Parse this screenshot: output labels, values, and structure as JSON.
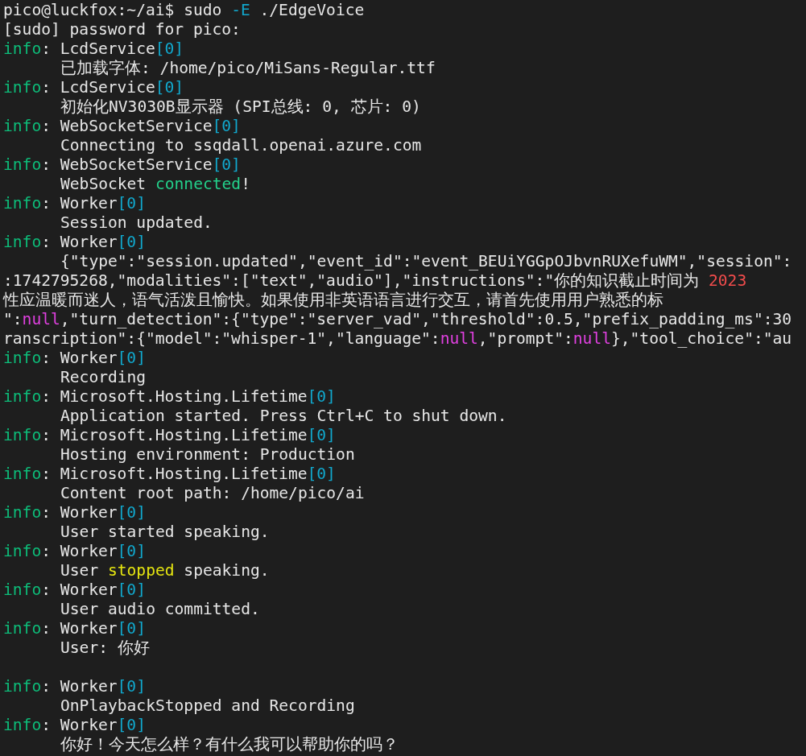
{
  "terminal": {
    "lines": [
      {
        "indent": false,
        "segments": [
          {
            "text": "pico@luckfox:~/ai$ sudo ",
            "color": "#e6e6e6"
          },
          {
            "text": "-E",
            "color": "#11a8cd"
          },
          {
            "text": " ./EdgeVoice",
            "color": "#e6e6e6"
          }
        ]
      },
      {
        "indent": false,
        "segments": [
          {
            "text": "[sudo] password for pico:",
            "color": "#e6e6e6"
          }
        ]
      },
      {
        "indent": false,
        "segments": [
          {
            "text": "info",
            "color": "#0dbc79"
          },
          {
            "text": ": LcdService",
            "color": "#e6e6e6"
          },
          {
            "text": "[0]",
            "color": "#11a8cd"
          }
        ]
      },
      {
        "indent": true,
        "segments": [
          {
            "text": "已加载字体: /home/pico/MiSans-Regular.ttf",
            "color": "#e6e6e6"
          }
        ]
      },
      {
        "indent": false,
        "segments": [
          {
            "text": "info",
            "color": "#0dbc79"
          },
          {
            "text": ": LcdService",
            "color": "#e6e6e6"
          },
          {
            "text": "[0]",
            "color": "#11a8cd"
          }
        ]
      },
      {
        "indent": true,
        "segments": [
          {
            "text": "初始化NV3030B显示器 (SPI总线: 0, 芯片: 0)",
            "color": "#e6e6e6"
          }
        ]
      },
      {
        "indent": false,
        "segments": [
          {
            "text": "info",
            "color": "#0dbc79"
          },
          {
            "text": ": WebSocketService",
            "color": "#e6e6e6"
          },
          {
            "text": "[0]",
            "color": "#11a8cd"
          }
        ]
      },
      {
        "indent": true,
        "segments": [
          {
            "text": "Connecting to ssqdall.openai.azure.com",
            "color": "#e6e6e6"
          }
        ]
      },
      {
        "indent": false,
        "segments": [
          {
            "text": "info",
            "color": "#0dbc79"
          },
          {
            "text": ": WebSocketService",
            "color": "#e6e6e6"
          },
          {
            "text": "[0]",
            "color": "#11a8cd"
          }
        ]
      },
      {
        "indent": true,
        "segments": [
          {
            "text": "WebSocket ",
            "color": "#e6e6e6"
          },
          {
            "text": "connected",
            "color": "#23d18b"
          },
          {
            "text": "!",
            "color": "#e6e6e6"
          }
        ]
      },
      {
        "indent": false,
        "segments": [
          {
            "text": "info",
            "color": "#0dbc79"
          },
          {
            "text": ": Worker",
            "color": "#e6e6e6"
          },
          {
            "text": "[0]",
            "color": "#11a8cd"
          }
        ]
      },
      {
        "indent": true,
        "segments": [
          {
            "text": "Session updated.",
            "color": "#e6e6e6"
          }
        ]
      },
      {
        "indent": false,
        "segments": [
          {
            "text": "info",
            "color": "#0dbc79"
          },
          {
            "text": ": Worker",
            "color": "#e6e6e6"
          },
          {
            "text": "[0]",
            "color": "#11a8cd"
          }
        ]
      },
      {
        "indent": true,
        "segments": [
          {
            "text": "{\"type\":\"session.updated\",\"event_id\":\"event_BEUiYGGpOJbvnRUXefuWM\",\"session\":",
            "color": "#e6e6e6"
          }
        ]
      },
      {
        "indent": false,
        "segments": [
          {
            "text": ":1742795268,\"modalities\":[\"text\",\"audio\"],\"instructions\":\"你的知识截止时间为 ",
            "color": "#e6e6e6"
          },
          {
            "text": "2023",
            "color": "#f14c4c"
          }
        ]
      },
      {
        "indent": false,
        "segments": [
          {
            "text": "性应温暖而迷人，语气活泼且愉快。如果使用非英语语言进行交互，请首先使用用户熟悉的标",
            "color": "#e6e6e6"
          }
        ]
      },
      {
        "indent": false,
        "segments": [
          {
            "text": "\":",
            "color": "#e6e6e6"
          },
          {
            "text": "null",
            "color": "#e040e0"
          },
          {
            "text": ",\"turn_detection\":{\"type\":\"server_vad\",\"threshold\":0.5,\"prefix_padding_ms\":30",
            "color": "#e6e6e6"
          }
        ]
      },
      {
        "indent": false,
        "segments": [
          {
            "text": "ranscription\":{\"model\":\"whisper-1\",\"language\":",
            "color": "#e6e6e6"
          },
          {
            "text": "null",
            "color": "#e040e0"
          },
          {
            "text": ",\"prompt\":",
            "color": "#e6e6e6"
          },
          {
            "text": "null",
            "color": "#e040e0"
          },
          {
            "text": "},\"tool_choice\":\"au",
            "color": "#e6e6e6"
          }
        ]
      },
      {
        "indent": false,
        "segments": [
          {
            "text": "info",
            "color": "#0dbc79"
          },
          {
            "text": ": Worker",
            "color": "#e6e6e6"
          },
          {
            "text": "[0]",
            "color": "#11a8cd"
          }
        ]
      },
      {
        "indent": true,
        "segments": [
          {
            "text": "Recording",
            "color": "#e6e6e6"
          }
        ]
      },
      {
        "indent": false,
        "segments": [
          {
            "text": "info",
            "color": "#0dbc79"
          },
          {
            "text": ": Microsoft.Hosting.Lifetime",
            "color": "#e6e6e6"
          },
          {
            "text": "[0]",
            "color": "#11a8cd"
          }
        ]
      },
      {
        "indent": true,
        "segments": [
          {
            "text": "Application started. Press Ctrl+C to shut down.",
            "color": "#e6e6e6"
          }
        ]
      },
      {
        "indent": false,
        "segments": [
          {
            "text": "info",
            "color": "#0dbc79"
          },
          {
            "text": ": Microsoft.Hosting.Lifetime",
            "color": "#e6e6e6"
          },
          {
            "text": "[0]",
            "color": "#11a8cd"
          }
        ]
      },
      {
        "indent": true,
        "segments": [
          {
            "text": "Hosting environment: Production",
            "color": "#e6e6e6"
          }
        ]
      },
      {
        "indent": false,
        "segments": [
          {
            "text": "info",
            "color": "#0dbc79"
          },
          {
            "text": ": Microsoft.Hosting.Lifetime",
            "color": "#e6e6e6"
          },
          {
            "text": "[0]",
            "color": "#11a8cd"
          }
        ]
      },
      {
        "indent": true,
        "segments": [
          {
            "text": "Content root path: /home/pico/ai",
            "color": "#e6e6e6"
          }
        ]
      },
      {
        "indent": false,
        "segments": [
          {
            "text": "info",
            "color": "#0dbc79"
          },
          {
            "text": ": Worker",
            "color": "#e6e6e6"
          },
          {
            "text": "[0]",
            "color": "#11a8cd"
          }
        ]
      },
      {
        "indent": true,
        "segments": [
          {
            "text": "User started speaking.",
            "color": "#e6e6e6"
          }
        ]
      },
      {
        "indent": false,
        "segments": [
          {
            "text": "info",
            "color": "#0dbc79"
          },
          {
            "text": ": Worker",
            "color": "#e6e6e6"
          },
          {
            "text": "[0]",
            "color": "#11a8cd"
          }
        ]
      },
      {
        "indent": true,
        "segments": [
          {
            "text": "User ",
            "color": "#e6e6e6"
          },
          {
            "text": "stopped",
            "color": "#e5e510"
          },
          {
            "text": " speaking.",
            "color": "#e6e6e6"
          }
        ]
      },
      {
        "indent": false,
        "segments": [
          {
            "text": "info",
            "color": "#0dbc79"
          },
          {
            "text": ": Worker",
            "color": "#e6e6e6"
          },
          {
            "text": "[0]",
            "color": "#11a8cd"
          }
        ]
      },
      {
        "indent": true,
        "segments": [
          {
            "text": "User audio committed.",
            "color": "#e6e6e6"
          }
        ]
      },
      {
        "indent": false,
        "segments": [
          {
            "text": "info",
            "color": "#0dbc79"
          },
          {
            "text": ": Worker",
            "color": "#e6e6e6"
          },
          {
            "text": "[0]",
            "color": "#11a8cd"
          }
        ]
      },
      {
        "indent": true,
        "segments": [
          {
            "text": "User: 你好",
            "color": "#e6e6e6"
          }
        ]
      },
      {
        "indent": false,
        "blank_before": true,
        "segments": [
          {
            "text": "info",
            "color": "#0dbc79"
          },
          {
            "text": ": Worker",
            "color": "#e6e6e6"
          },
          {
            "text": "[0]",
            "color": "#11a8cd"
          }
        ]
      },
      {
        "indent": true,
        "segments": [
          {
            "text": "OnPlaybackStopped and Recording",
            "color": "#e6e6e6"
          }
        ]
      },
      {
        "indent": false,
        "segments": [
          {
            "text": "info",
            "color": "#0dbc79"
          },
          {
            "text": ": Worker",
            "color": "#e6e6e6"
          },
          {
            "text": "[0]",
            "color": "#11a8cd"
          }
        ]
      },
      {
        "indent": true,
        "segments": [
          {
            "text": "你好！今天怎么样？有什么我可以帮助你的吗？",
            "color": "#e6e6e6"
          }
        ]
      }
    ]
  }
}
